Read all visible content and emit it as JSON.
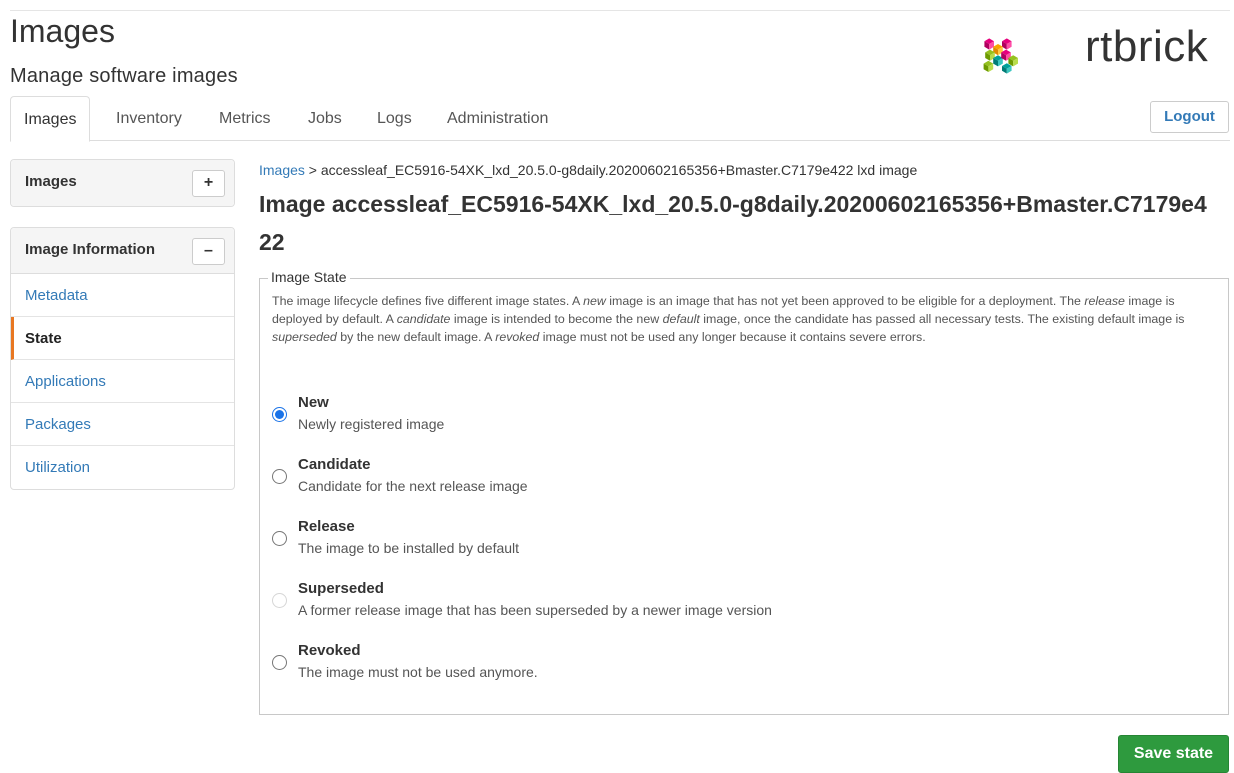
{
  "header": {
    "title": "Images",
    "subtitle": "Manage software images",
    "brand": "rtbrick",
    "logo_icon": "rtbrick-cube-logo"
  },
  "tabs": [
    {
      "label": "Images",
      "active": true
    },
    {
      "label": "Inventory",
      "active": false
    },
    {
      "label": "Metrics",
      "active": false
    },
    {
      "label": "Jobs",
      "active": false
    },
    {
      "label": "Logs",
      "active": false
    },
    {
      "label": "Administration",
      "active": false
    }
  ],
  "logout_label": "Logout",
  "sidebar": {
    "images_panel": {
      "title": "Images",
      "button": "+"
    },
    "info_panel": {
      "title": "Image Information",
      "button": "–",
      "items": [
        {
          "label": "Metadata",
          "active": false
        },
        {
          "label": "State",
          "active": true
        },
        {
          "label": "Applications",
          "active": false
        },
        {
          "label": "Packages",
          "active": false
        },
        {
          "label": "Utilization",
          "active": false
        }
      ]
    }
  },
  "breadcrumb": {
    "link": "Images",
    "separator": " > ",
    "current": "accessleaf_EC5916-54XK_lxd_20.5.0-g8daily.20200602165356+Bmaster.C7179e422 lxd image"
  },
  "image_title": "Image accessleaf_EC5916-54XK_lxd_20.5.0-g8daily.20200602165356+Bmaster.C7179e422",
  "state_section": {
    "legend": "Image State",
    "description": {
      "p1": "The image lifecycle defines five different image states. A ",
      "e1": "new",
      "p2": " image is an image that has not yet been approved to be eligible for a deployment. The ",
      "e2": "release",
      "p3": " image is deployed by default. A ",
      "e3": "candidate",
      "p4": " image is intended to become the new ",
      "e4": "default",
      "p5": " image, once the candidate has passed all necessary tests. The existing default image is ",
      "e5": "superseded",
      "p6": " by the new default image. A ",
      "e6": "revoked",
      "p7": " image must not be used any longer because it contains severe errors."
    },
    "options": [
      {
        "title": "New",
        "description": "Newly registered image",
        "checked": true,
        "disabled": false
      },
      {
        "title": "Candidate",
        "description": "Candidate for the next release image",
        "checked": false,
        "disabled": false
      },
      {
        "title": "Release",
        "description": "The image to be installed by default",
        "checked": false,
        "disabled": false
      },
      {
        "title": "Superseded",
        "description": "A former release image that has been superseded by a newer image version",
        "checked": false,
        "disabled": true
      },
      {
        "title": "Revoked",
        "description": "The image must not be used anymore.",
        "checked": false,
        "disabled": false
      }
    ]
  },
  "save_label": "Save state",
  "colors": {
    "link": "#337ab7",
    "accent_active": "#e87722",
    "save_button": "#2e9a3e",
    "radio_checked": "#1a73e8"
  }
}
